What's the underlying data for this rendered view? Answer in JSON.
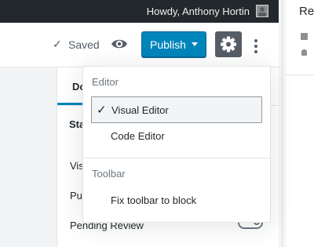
{
  "admin_bar": {
    "greeting": "Howdy, Anthony Hortin"
  },
  "header": {
    "saved_label": "Saved",
    "publish_label": "Publish"
  },
  "sidebar": {
    "active_tab": "Do",
    "section_title": "Sta",
    "rows": [
      "Vis",
      "Pu",
      "Pending Review"
    ]
  },
  "next_panel": {
    "title": "Re"
  },
  "menu": {
    "editor_group": "Editor",
    "items": [
      {
        "label": "Visual Editor",
        "selected": true
      },
      {
        "label": "Code Editor",
        "selected": false
      }
    ],
    "toolbar_group": "Toolbar",
    "toolbar_item": "Fix toolbar to block"
  },
  "colors": {
    "publish": "#0085ba",
    "admin_bar": "#23282d",
    "settings_active": "#555d66"
  },
  "icons": {
    "saved": "check-icon",
    "preview": "eye-icon",
    "settings": "gear-icon",
    "more": "vertical-ellipsis-icon"
  }
}
